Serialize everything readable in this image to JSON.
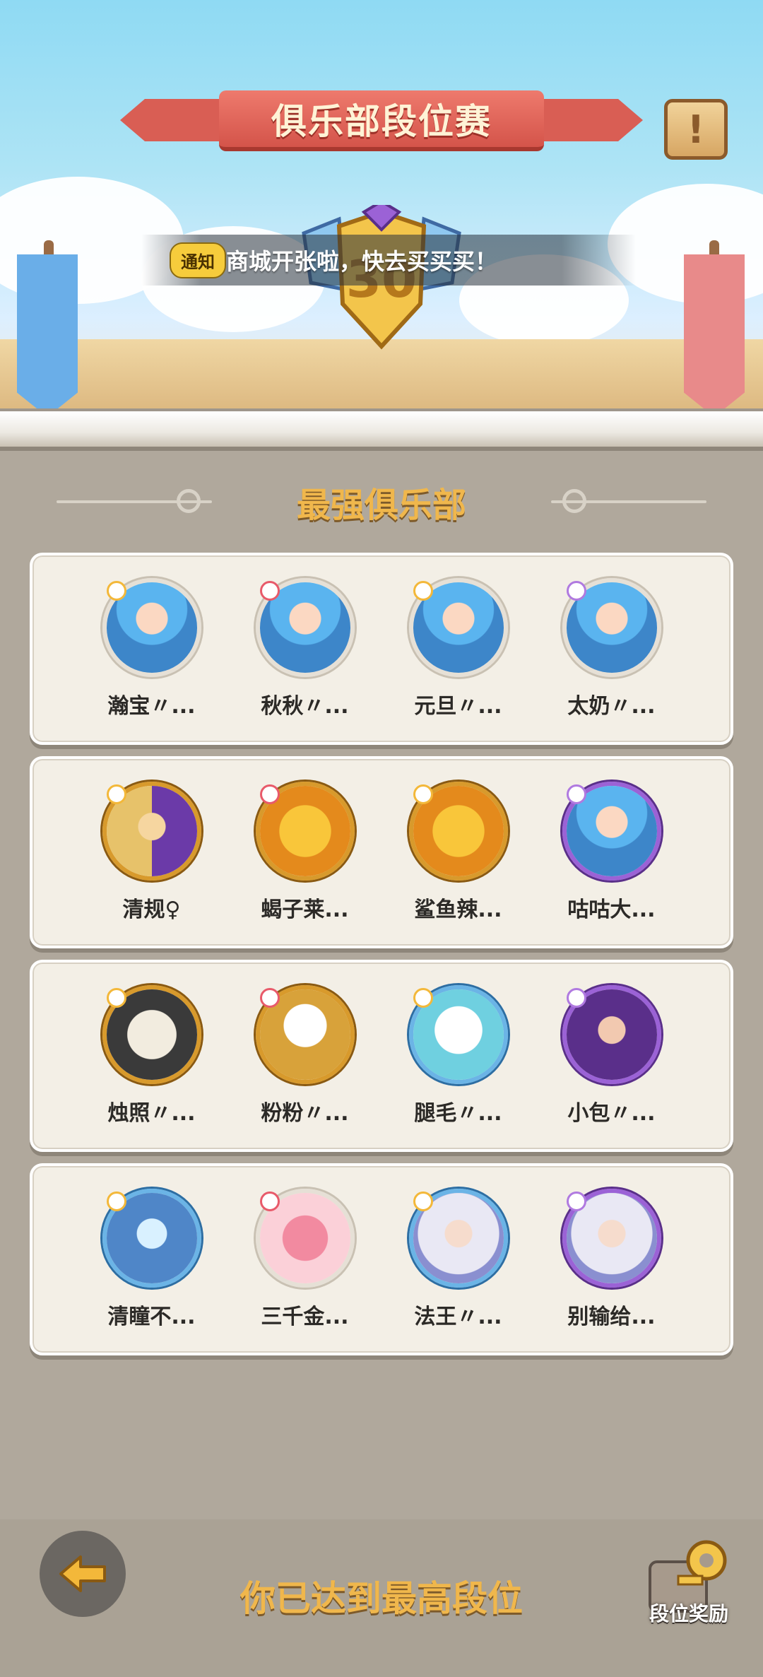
{
  "header": {
    "title": "俱乐部段位赛",
    "info_icon": "exclamation-scroll-icon"
  },
  "notice": {
    "tag": "通知",
    "text": "商城开张啦，快去买买买！"
  },
  "rank_emblem": {
    "value": "30"
  },
  "section": {
    "title": "最强俱乐部"
  },
  "clubs": [
    {
      "members": [
        {
          "name": "瀚宝〃...",
          "frame": "plain",
          "portrait": "blue-hair-hero"
        },
        {
          "name": "秋秋〃...",
          "frame": "plain",
          "portrait": "blue-hair-hero"
        },
        {
          "name": "元旦〃...",
          "frame": "plain",
          "portrait": "blue-hair-hero"
        },
        {
          "name": "太奶〃...",
          "frame": "plain",
          "portrait": "blue-hair-hero"
        }
      ]
    },
    {
      "members": [
        {
          "name": "清规♀",
          "frame": "gold",
          "portrait": "winged-knight"
        },
        {
          "name": "蝎子莱...",
          "frame": "gold",
          "portrait": "sun-sunglasses"
        },
        {
          "name": "鲨鱼辣...",
          "frame": "gold",
          "portrait": "sun-sunglasses"
        },
        {
          "name": "咕咕大...",
          "frame": "purple",
          "portrait": "blue-hair-hero"
        }
      ]
    },
    {
      "members": [
        {
          "name": "烛照〃...",
          "frame": "gold",
          "portrait": "panda"
        },
        {
          "name": "粉粉〃...",
          "frame": "gold",
          "portrait": "eagle"
        },
        {
          "name": "腿毛〃...",
          "frame": "blue",
          "portrait": "snow-spirit"
        },
        {
          "name": "小包〃...",
          "frame": "purple",
          "portrait": "dark-warrior"
        }
      ]
    },
    {
      "members": [
        {
          "name": "清瞳不...",
          "frame": "blue",
          "portrait": "robot-knight"
        },
        {
          "name": "三千金...",
          "frame": "plain",
          "portrait": "bird-couple"
        },
        {
          "name": "法王〃...",
          "frame": "blue",
          "portrait": "white-hair-girl"
        },
        {
          "name": "别输给...",
          "frame": "purple",
          "portrait": "white-hair-girl"
        }
      ]
    }
  ],
  "footer": {
    "status_text": "你已达到最高段位",
    "reward_label": "段位奖励",
    "back_icon": "back-arrow-icon"
  },
  "colors": {
    "title_gold": "#f0b74c",
    "ribbon_red": "#d95e54",
    "card_bg": "#f3efe6",
    "page_bg": "#b0a89c"
  }
}
